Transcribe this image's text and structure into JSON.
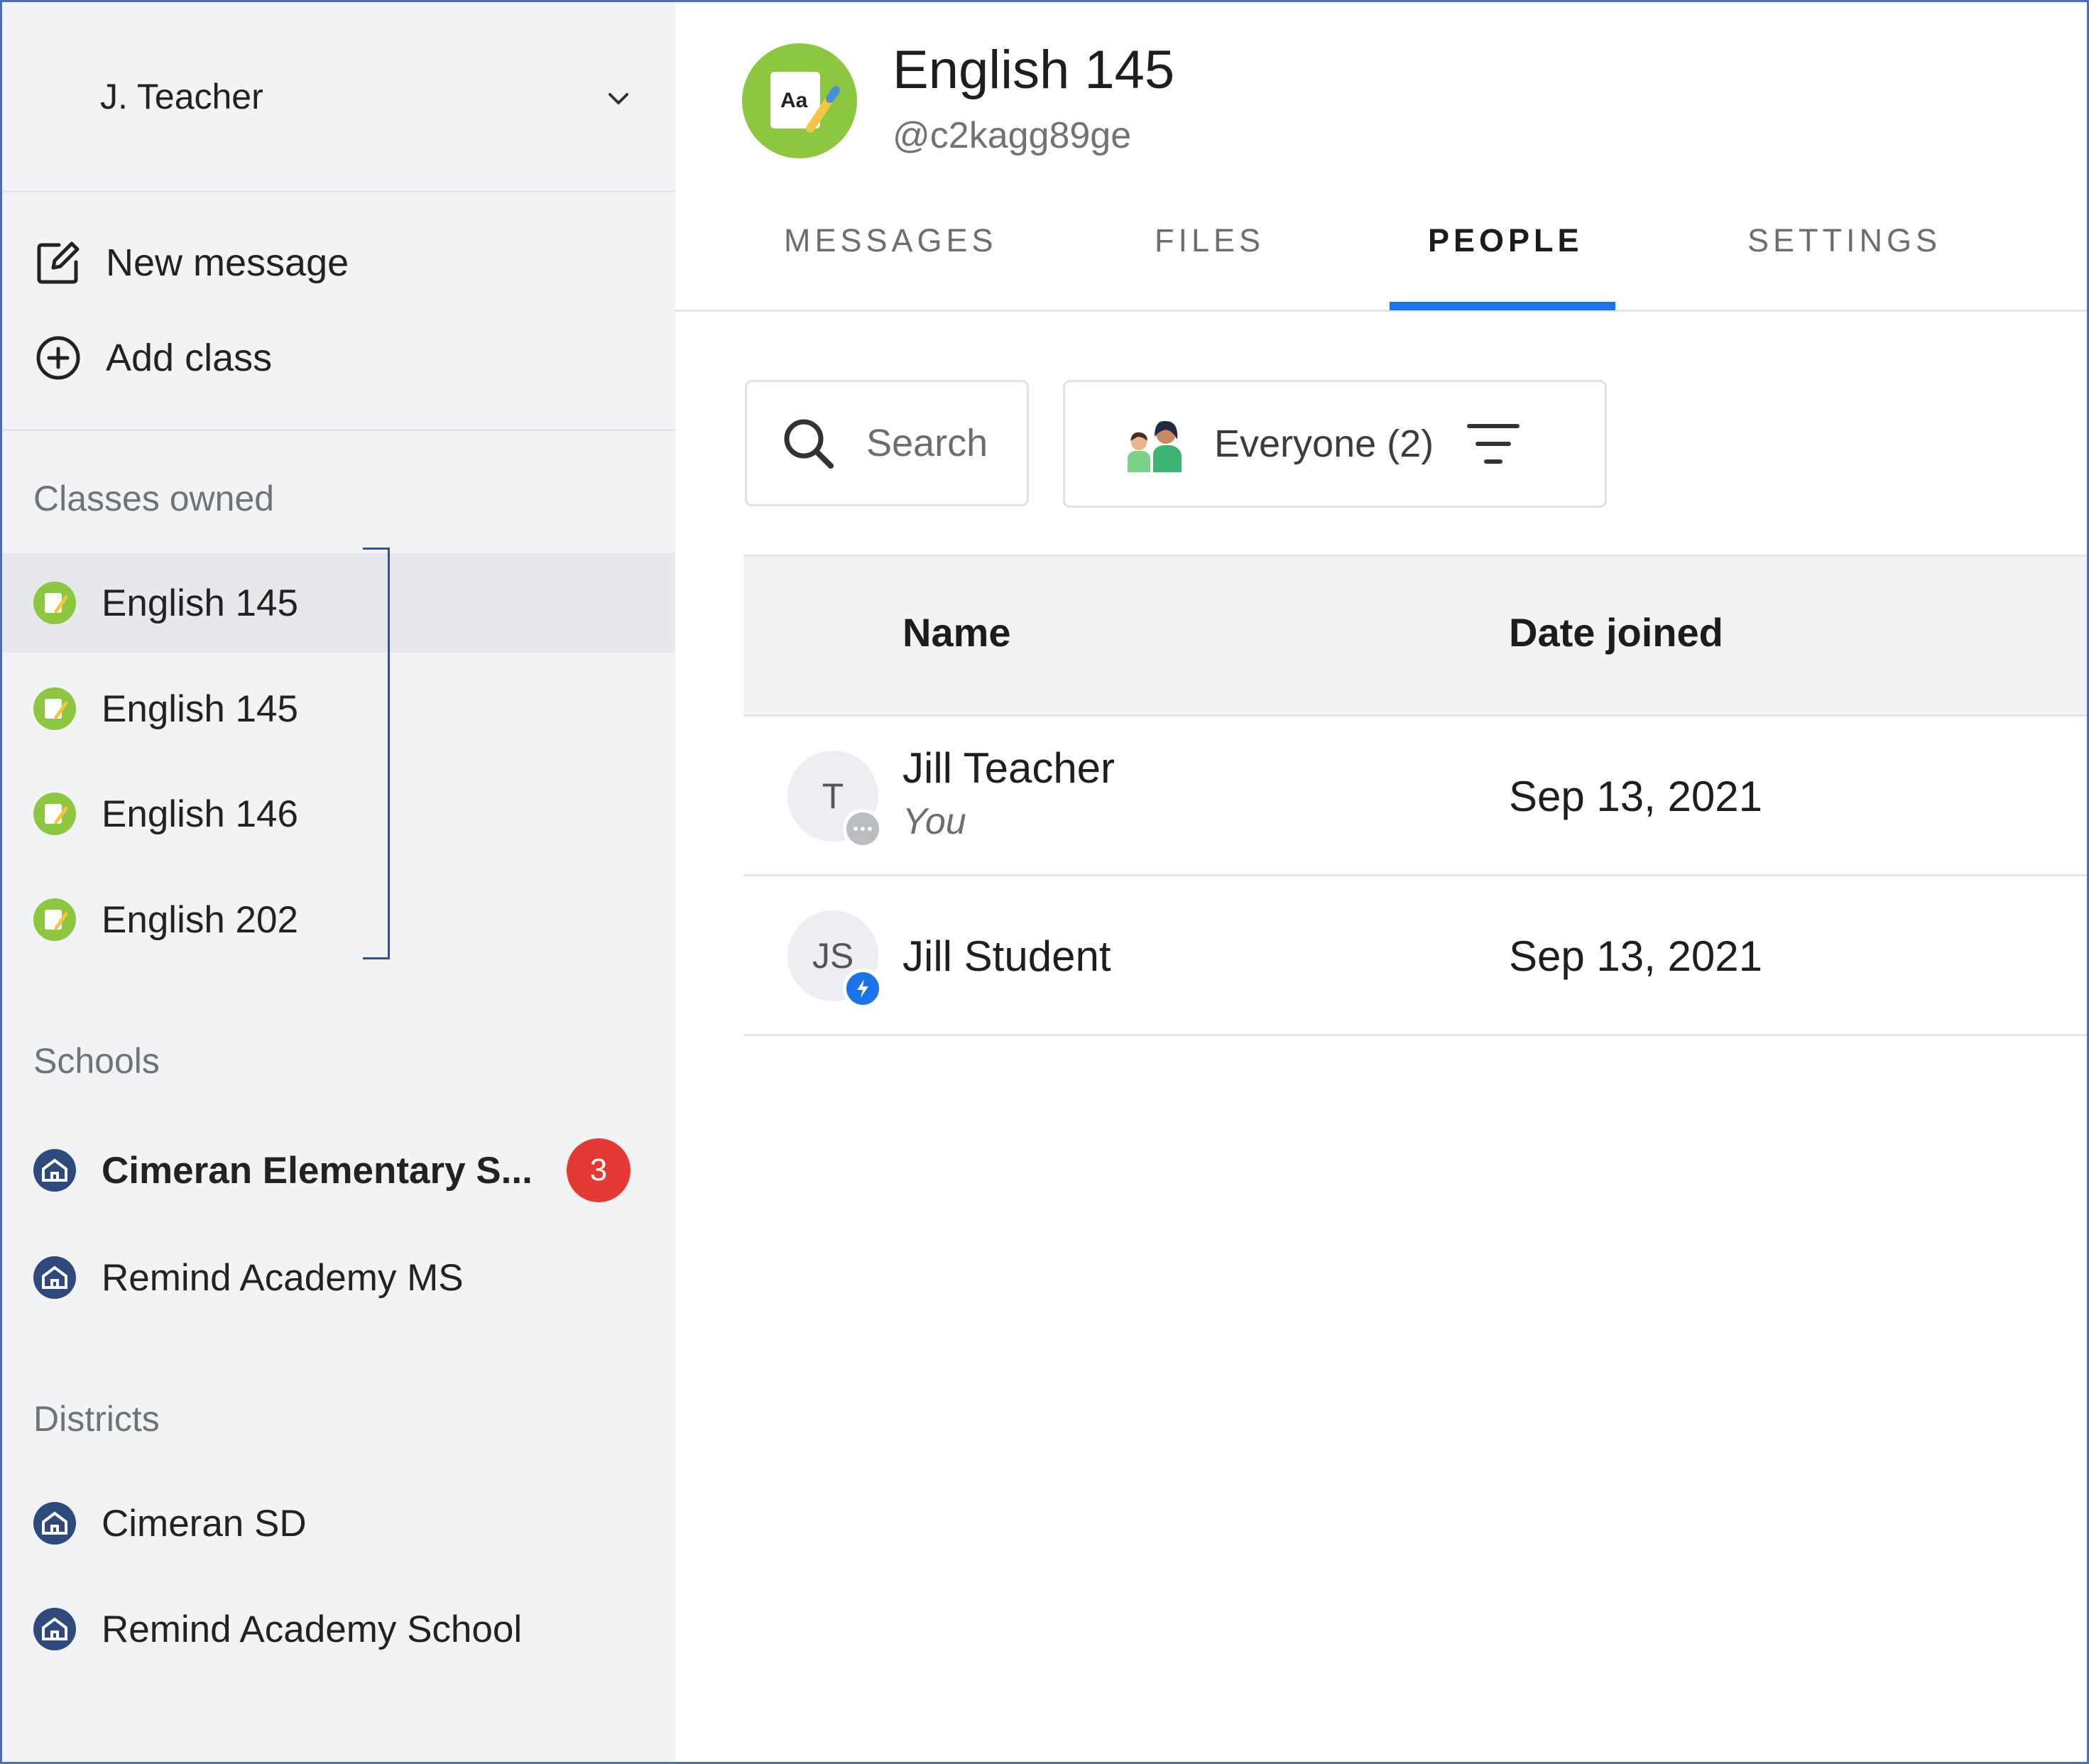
{
  "account": {
    "name": "J. Teacher"
  },
  "actions": {
    "new_message": "New message",
    "add_class": "Add class"
  },
  "sections": {
    "classes_owned": "Classes owned",
    "schools": "Schools",
    "districts": "Districts"
  },
  "classes": [
    {
      "label": "English 145",
      "selected": true
    },
    {
      "label": "English 145",
      "selected": false
    },
    {
      "label": "English 146",
      "selected": false
    },
    {
      "label": "English 202",
      "selected": false
    }
  ],
  "schools": [
    {
      "label": "Cimeran Elementary S...",
      "badge": "3"
    },
    {
      "label": "Remind Academy MS"
    }
  ],
  "districts": [
    {
      "label": "Cimeran SD"
    },
    {
      "label": "Remind Academy School"
    }
  ],
  "header": {
    "title": "English 145",
    "code": "@c2kagg89ge",
    "logo_text": "Aa"
  },
  "tabs": [
    {
      "label": "MESSAGES",
      "active": false
    },
    {
      "label": "FILES",
      "active": false
    },
    {
      "label": "PEOPLE",
      "active": true
    },
    {
      "label": "SETTINGS",
      "active": false
    }
  ],
  "search": {
    "placeholder": "Search"
  },
  "filter": {
    "label": "Everyone (2)"
  },
  "table": {
    "columns": [
      "Name",
      "Date joined"
    ],
    "rows": [
      {
        "initials": "T",
        "name": "Jill Teacher",
        "sub": "You",
        "date": "Sep 13, 2021",
        "badge_icon": "more-icon"
      },
      {
        "initials": "JS",
        "name": "Jill Student",
        "sub": "",
        "date": "Sep 13, 2021",
        "badge_icon": "bolt-icon"
      }
    ]
  },
  "colors": {
    "accent": "#1a73e8",
    "badge_red": "#e53935",
    "class_icon_green": "#8dc63f",
    "school_icon_navy": "#2e4a7d"
  }
}
